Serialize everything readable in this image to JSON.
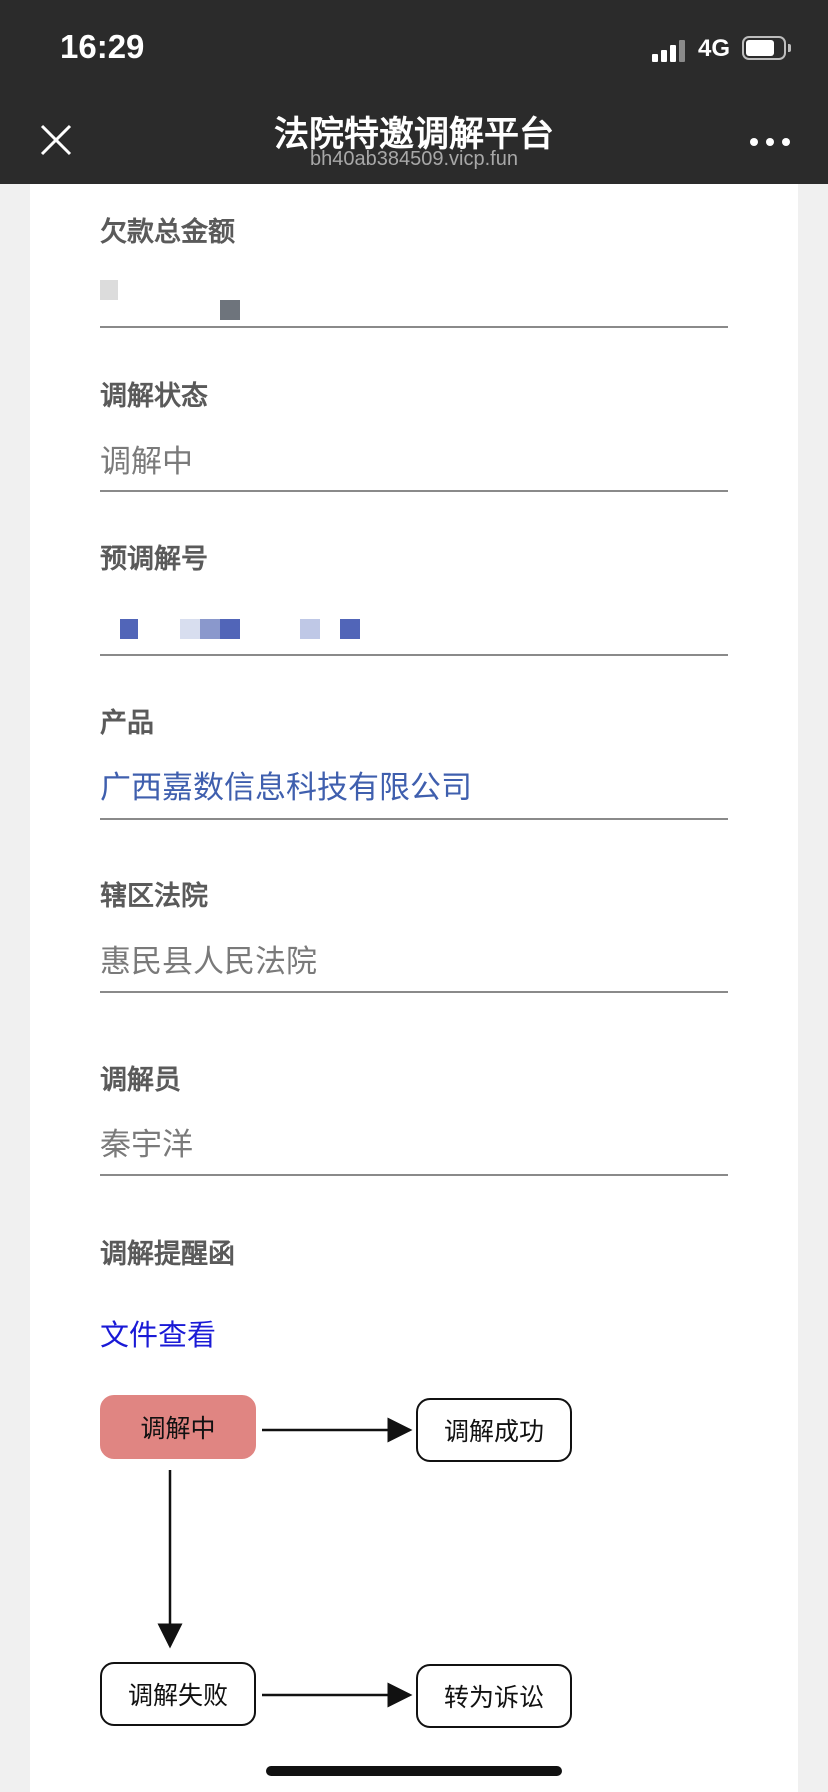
{
  "status_bar": {
    "time": "16:29",
    "network": "4G",
    "icons": [
      "signal-icon",
      "battery-icon"
    ]
  },
  "nav": {
    "title": "法院特邀调解平台",
    "subtitle": "bh40ab384509.vicp.fun",
    "icons": [
      "close-icon",
      "more-icon"
    ]
  },
  "fields": [
    {
      "label": "欠款总金额",
      "value": ""
    },
    {
      "label": "调解状态",
      "value": "调解中"
    },
    {
      "label": "预调解号",
      "value": ""
    },
    {
      "label": "产品",
      "value": "广西嘉数信息科技有限公司"
    },
    {
      "label": "辖区法院",
      "value": "惠民县人民法院"
    },
    {
      "label": "调解员",
      "value": "秦宇洋"
    },
    {
      "label": "调解提醒函",
      "link": "文件查看"
    }
  ],
  "colors": {
    "product_link": "#3f5fae",
    "file_link": "#1a1ad6",
    "active_node": "#e08582"
  },
  "flow": {
    "nodes": [
      "调解中",
      "调解成功",
      "调解失败",
      "转为诉讼"
    ],
    "active": "调解中"
  }
}
